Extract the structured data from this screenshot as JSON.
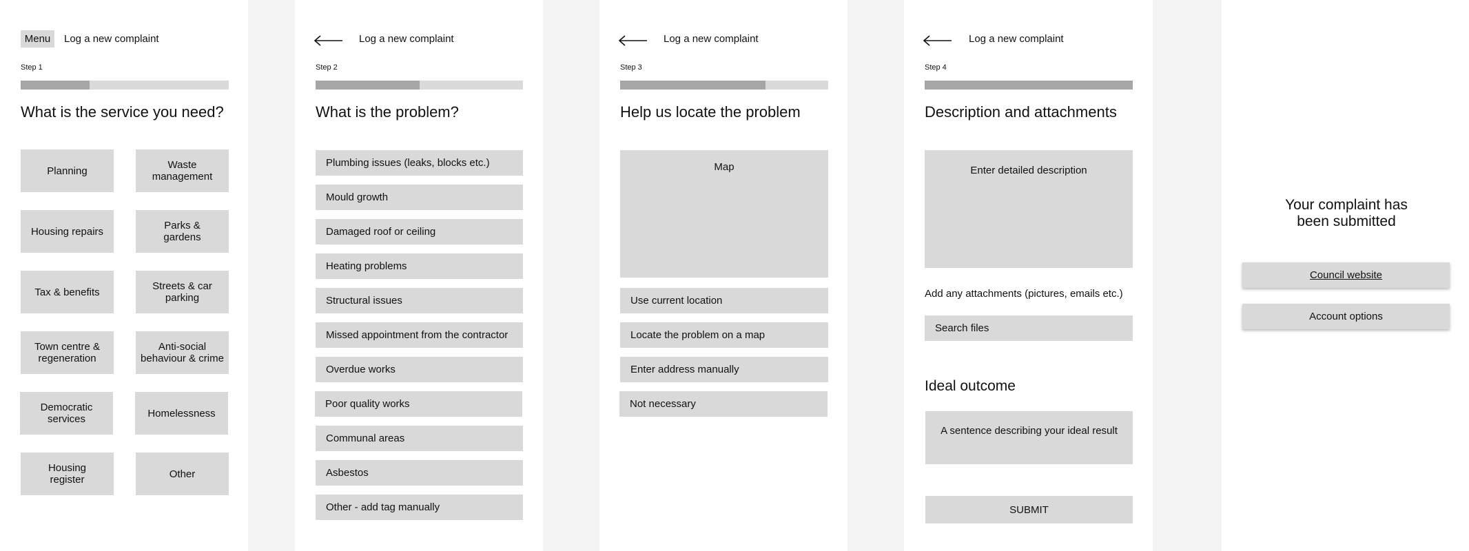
{
  "screen1": {
    "menu_label": "Menu",
    "title": "Log a new complaint",
    "step": "Step 1",
    "progress": 0.33,
    "heading": "What is the service you need?",
    "services": [
      "Planning",
      "Waste management",
      "Housing repairs",
      "Parks & gardens",
      "Tax & benefits",
      "Streets & car parking",
      "Town centre & regeneration",
      "Anti-social behaviour & crime",
      "Democratic services",
      "Homelessness",
      "Housing register",
      "Other"
    ]
  },
  "screen2": {
    "title": "Log a new complaint",
    "step": "Step 2",
    "progress": 0.5,
    "heading": "What is the problem?",
    "problems": [
      "Plumbing issues (leaks, blocks etc.)",
      "Mould growth",
      "Damaged roof or ceiling",
      "Heating problems",
      "Structural issues",
      "Missed appointment from the contractor",
      "Overdue works",
      "Poor quality works",
      "Communal areas",
      "Asbestos",
      "Other - add tag manually"
    ]
  },
  "screen3": {
    "title": "Log a new complaint",
    "step": "Step 3",
    "progress": 0.7,
    "heading": "Help us locate the problem",
    "map_label": "Map",
    "options": [
      "Use current location",
      "Locate the problem on a map",
      "Enter address manually",
      "Not necessary"
    ]
  },
  "screen4": {
    "title": "Log a new complaint",
    "step": "Step 4",
    "progress": 1.0,
    "heading": "Description and attachments",
    "description_placeholder": "Enter detailed description",
    "attachments_label": "Add any attachments (pictures, emails etc.)",
    "search_files": "Search files",
    "outcome_heading": "Ideal outcome",
    "outcome_placeholder": "A sentence describing your ideal result",
    "submit": "SUBMIT"
  },
  "screen5": {
    "confirmation": "Your complaint has been submitted",
    "council_website": "Council website",
    "account_options": "Account options"
  },
  "colors": {
    "background": "#f3f3f3",
    "panel": "#ffffff",
    "button_fill": "#d9d9d9",
    "progress_track": "#dadada",
    "progress_fill": "#a6a6a6"
  },
  "icons": {
    "back": "arrow-left-icon"
  }
}
